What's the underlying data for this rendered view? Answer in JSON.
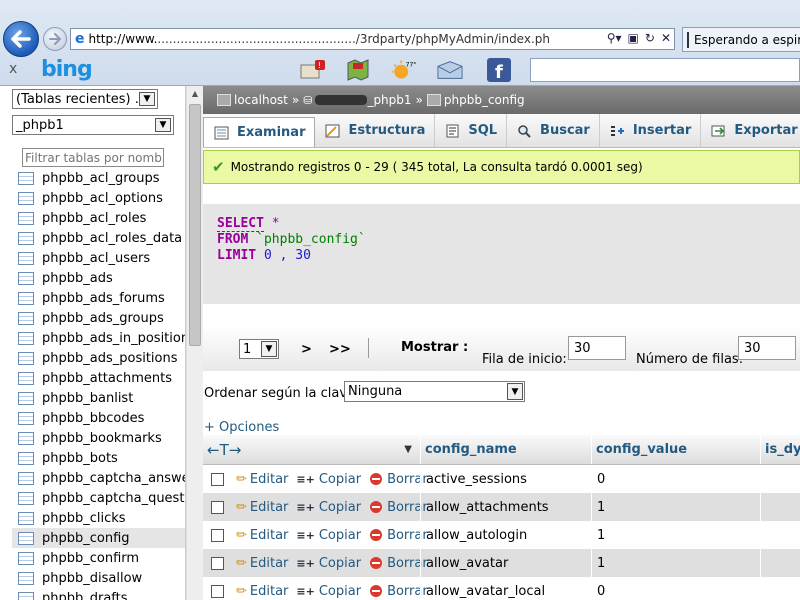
{
  "browser": {
    "address_url": "http://www.",
    "address_url_rest": "..................................................../3rdparty/phpMyAdmin/index.ph",
    "tab_title": "Esperando a espir",
    "toolbar_brand": "bing"
  },
  "sidebar": {
    "recent_tables": "(Tablas recientes) ...",
    "database": "_phpb1",
    "filter_placeholder": "Filtrar tablas por nombre",
    "tables": [
      "phpbb_acl_groups",
      "phpbb_acl_options",
      "phpbb_acl_roles",
      "phpbb_acl_roles_data",
      "phpbb_acl_users",
      "phpbb_ads",
      "phpbb_ads_forums",
      "phpbb_ads_groups",
      "phpbb_ads_in_positions",
      "phpbb_ads_positions",
      "phpbb_attachments",
      "phpbb_banlist",
      "phpbb_bbcodes",
      "phpbb_bookmarks",
      "phpbb_bots",
      "phpbb_captcha_answers",
      "phpbb_captcha_questions",
      "phpbb_clicks",
      "phpbb_config",
      "phpbb_confirm",
      "phpbb_disallow",
      "phpbb_drafts"
    ],
    "active_table": "phpbb_config"
  },
  "breadcrumb": {
    "server": "localhost",
    "database": "_phpb1",
    "table": "phpbb_config",
    "separator": "»"
  },
  "tabs": [
    {
      "label": "Examinar",
      "icon": "browse-icon",
      "active": true
    },
    {
      "label": "Estructura",
      "icon": "structure-icon",
      "active": false
    },
    {
      "label": "SQL",
      "icon": "sql-icon",
      "active": false
    },
    {
      "label": "Buscar",
      "icon": "search-icon",
      "active": false
    },
    {
      "label": "Insertar",
      "icon": "insert-icon",
      "active": false
    },
    {
      "label": "Exportar",
      "icon": "export-icon",
      "active": false
    }
  ],
  "notice": "Mostrando registros 0 - 29 ( 345 total, La consulta tardó 0.0001 seg)",
  "sql": {
    "select": "SELECT",
    "star": "*",
    "from": "FROM",
    "table": "`phpbb_config`",
    "limit": "LIMIT",
    "offset": "0",
    "comma": ",",
    "count": "30"
  },
  "pager": {
    "page": "1",
    "next": ">",
    "last": ">>",
    "show_label": "Mostrar :",
    "start_label": "Fila de inicio:",
    "start_value": "30",
    "rows_label": "Número de filas:",
    "rows_value": "30"
  },
  "order": {
    "label": "Ordenar según la clave:",
    "value": "Ninguna"
  },
  "options_link": "+ Opciones",
  "table": {
    "sort_arrows": "←T→",
    "columns": [
      "config_name",
      "config_value",
      "is_dyn"
    ],
    "actions": {
      "edit": "Editar",
      "copy": "Copiar",
      "delete": "Borrar"
    },
    "rows": [
      {
        "name": "active_sessions",
        "value": "0"
      },
      {
        "name": "allow_attachments",
        "value": "1"
      },
      {
        "name": "allow_autologin",
        "value": "1"
      },
      {
        "name": "allow_avatar",
        "value": "1"
      },
      {
        "name": "allow_avatar_local",
        "value": "0"
      }
    ]
  },
  "colors": {
    "link": "#235a81",
    "notice_bg": "#ebf8a4",
    "row_alt": "#dfdfdf"
  }
}
